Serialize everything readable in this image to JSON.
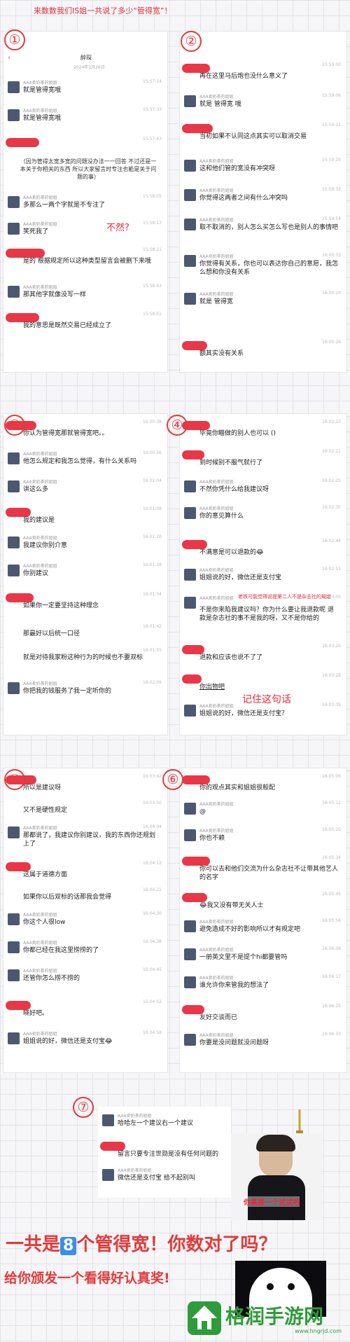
{
  "page": {
    "header_annotation": "来数数我们IS姐一共说了多少“管得宽”！",
    "sticker_text": "鬼鬼",
    "big_question": "一共是8个管得宽！你数对了吗？",
    "big_question_pre": "一共是",
    "big_question_num": "8",
    "big_question_post": "个管得宽！你数对了吗？",
    "award_text": "给你颁发一个看得好认真奖!",
    "watermark_site": "格润手游网",
    "watermark_url": "www.hngrjd.com"
  },
  "panels": [
    {
      "num": "①",
      "header_title": "醉琛",
      "header_date": "2024年3月26日",
      "annotations": [
        {
          "text": "不然?"
        }
      ],
      "messages": [
        {
          "kind": "named",
          "name": "AAA卖奶茶的姐姐",
          "text": "就是管得宽哦",
          "time": "15:57:14"
        },
        {
          "kind": "named",
          "name": "AAA卖奶茶的姐姐",
          "text": "就是管得宽哦",
          "time": "15:57:33"
        },
        {
          "kind": "smear",
          "text": "",
          "time": "15:57:43"
        },
        {
          "kind": "note",
          "text": "（因为管得太宽多宽的问题没办法一一回答 不过还是一本关于你相关的东西 所以大家留言时专注也能是关于问题的事）"
        },
        {
          "kind": "named",
          "name": "AAA卖奶茶的姐姐",
          "text": "多那么一两个字就是不专注了",
          "time": "15:58:05"
        },
        {
          "kind": "named",
          "name": "AAA卖奶茶的姐姐",
          "text": "笑死我了",
          "time": "15:58:13"
        },
        {
          "kind": "smear",
          "text": "是的 根据规定所以这种类型留言会被删下来哦",
          "time": "15:58:21"
        },
        {
          "kind": "named",
          "name": "AAA卖奶茶的姐姐",
          "text": "那其他字就像没写一样",
          "time": "15:58:43"
        },
        {
          "kind": "smear",
          "text": "我的意思是既然交易已经成立了",
          "time": "15:58:51"
        }
      ]
    },
    {
      "num": "②",
      "messages": [
        {
          "kind": "smear",
          "text": "再在这里马后炮也没什么意义了",
          "time": "15:59:00"
        },
        {
          "kind": "named",
          "name": "AAA卖奶茶的姐姐",
          "text": "就是 管得宽 哦",
          "time": "15:59:06"
        },
        {
          "kind": "smear",
          "text": "当初如果不认同这点其实可以取消交易",
          "time": "15:59:11"
        },
        {
          "kind": "named",
          "name": "AAA卖奶茶的姐姐",
          "text": "这和他们管的宽没有冲突呀",
          "time": "15:59:20"
        },
        {
          "kind": "named",
          "name": "AAA卖奶茶的姐姐",
          "text": "你觉得这两者之间有什么冲突吗",
          "time": "15:59:32"
        },
        {
          "kind": "named",
          "name": "AAA卖奶茶的姐姐",
          "text": "取不取消的，别人怎么买怎么写也是别人的事情吧",
          "time": "15:59:54"
        },
        {
          "kind": "named",
          "name": "AAA卖奶茶的姐姐",
          "text": "你觉得有关系，你也可以表达你自己的意愿，我怎么想和你没有关系",
          "time": "16:00:15"
        },
        {
          "kind": "named",
          "name": "AAA卖奶茶的姐姐",
          "text": "就是 管得宽",
          "time": "16:00:20"
        },
        {
          "kind": "smear",
          "text": "额其实没有关系",
          "time": "16:00:29"
        }
      ]
    },
    {
      "num": "③",
      "messages": [
        {
          "kind": "smear",
          "text": "你认为管得宽那就管得宽吧。。",
          "time": "16:00:38"
        },
        {
          "kind": "named",
          "name": "AAA卖奶茶的姐姐",
          "text": "他怎么规定和我怎么觉得，有什么关系吗",
          "time": "16:00:56"
        },
        {
          "kind": "named",
          "name": "AAA卖奶茶的姐姐",
          "text": "讲这么多",
          "time": "16:01:04"
        },
        {
          "kind": "smear",
          "text": "我的建议是",
          "time": "16:01:08"
        },
        {
          "kind": "named",
          "name": "AAA卖奶茶的姐姐",
          "text": "我建议你别介意",
          "time": "16:01:20"
        },
        {
          "kind": "named",
          "name": "AAA卖奶茶的姐姐",
          "text": "你别建议",
          "time": "16:01:28"
        },
        {
          "kind": "smear",
          "text": "如果你一定要坚持这种理念",
          "time": "16:01:34"
        },
        {
          "kind": "plain",
          "text": "那最好以后统一口径",
          "time": "16:01:42"
        },
        {
          "kind": "plain",
          "text": "就是对待我家粉这种行为的时候也不要双标",
          "time": "16:01:55"
        },
        {
          "kind": "named",
          "name": "AAA卖奶茶的姐姐",
          "text": "你把我的钱服务了我一定听你的",
          "time": "16:02:09"
        }
      ]
    },
    {
      "num": "④",
      "annotations": [
        {
          "text": "老铁可能觉得说提第二人不是杂志社的规定"
        },
        {
          "text": "记住这句话"
        }
      ],
      "messages": [
        {
          "kind": "smear",
          "text": "毕竟你瞄做的别人也可以 ()",
          "time": "16:02:15"
        },
        {
          "kind": "smear",
          "text": "到时候别不服气就行了",
          "time": "16:02:21"
        },
        {
          "kind": "named",
          "name": "AAA卖奶茶的姐姐",
          "text": "不然你凭什么给我建议呀",
          "time": "16:02:25"
        },
        {
          "kind": "named",
          "name": "AAA卖奶茶的姐姐",
          "text": "你的意见算什么",
          "time": "16:02:30"
        },
        {
          "kind": "smear",
          "text": "不满意是可以退款的😂",
          "time": "16:02:44"
        },
        {
          "kind": "named",
          "name": "AAA卖奶茶的姐姐",
          "text": "姐姐说的好，微信还是支付宝",
          "time": "16:02:51"
        },
        {
          "kind": "named",
          "name": "AAA卖奶茶的姐姐",
          "text": "不是你来陷我建议吗？你为什么要让我退款呢 退款是杂志社的事不是我的呀，又不是你给的",
          "time": "16:03:05"
        },
        {
          "kind": "smear",
          "text": "退款和应该也说不了了",
          "time": "16:03:20"
        },
        {
          "kind": "smear",
          "text": "你出物吧",
          "time": "16:03:28"
        },
        {
          "kind": "named",
          "name": "AAA卖奶茶的姐姐",
          "text": "姐姐说的好，微信还是支付宝？",
          "time": "16:03:35"
        }
      ]
    },
    {
      "num": "⑤",
      "messages": [
        {
          "kind": "smear",
          "text": "所以是建议呀",
          "time": "16:03:42"
        },
        {
          "kind": "plain",
          "text": "又不是硬性规定",
          "time": "16:03:50"
        },
        {
          "kind": "named",
          "name": "AAA卖奶茶的姐姐",
          "text": "那都说了，我建议你别建议，我的东西你还规划上了",
          "time": "16:04:04"
        },
        {
          "kind": "smear",
          "text": "这属于道德方面",
          "time": "16:04:12"
        },
        {
          "kind": "plain",
          "text": "如果你以后双标的话那我会觉得",
          "time": "16:04:21"
        },
        {
          "kind": "named",
          "name": "AAA卖奶茶的姐姐",
          "text": "你这个人很low",
          "time": "16:04:30"
        },
        {
          "kind": "named",
          "name": "AAA卖奶茶的姐姐",
          "text": "你都已经在我这里捞捞的了",
          "time": "16:04:38"
        },
        {
          "kind": "named",
          "name": "AAA卖奶茶的姐姐",
          "text": "还管你怎么捞不捞的",
          "time": "16:04:45"
        },
        {
          "kind": "smear",
          "text": "晓好吧。",
          "time": "16:04:52"
        },
        {
          "kind": "named",
          "name": "AAA卖奶茶的姐姐",
          "text": "姐姐说的好，微信还是支付宝😂",
          "time": "16:04:58"
        }
      ]
    },
    {
      "num": "⑥",
      "messages": [
        {
          "kind": "smear",
          "text": "你的观点其实和姐姐很般配",
          "time": "16:05:06"
        },
        {
          "kind": "named",
          "name": "AAA卖奶茶的姐姐",
          "text": "@",
          "time": "16:05:12"
        },
        {
          "kind": "named",
          "name": "AAA卖奶茶的姐姐",
          "text": "你也不赖",
          "time": "16:05:20"
        },
        {
          "kind": "smear",
          "text": "你可以去和他们交流为什么杂志社不让带其他艺人的名字",
          "time": "16:05:34"
        },
        {
          "kind": "smear",
          "text": "😂我又没有带无关人士",
          "time": "16:05:45"
        },
        {
          "kind": "named",
          "name": "AAA卖奶茶的姐姐",
          "text": "避免造成不好的影响所以才有规定吧",
          "time": "16:05:56"
        },
        {
          "kind": "named",
          "name": "AAA卖奶茶的姐姐",
          "text": "一册英文里不是提个hi都要管吗",
          "time": "16:06:08"
        },
        {
          "kind": "named",
          "name": "AAA卖奶茶的姐姐",
          "text": "谁允许你来管我的想法了",
          "time": "16:06:17"
        },
        {
          "kind": "smear",
          "text": "友好交谈而已",
          "time": "16:06:25"
        },
        {
          "kind": "named",
          "name": "AAA卖奶茶的姐姐",
          "text": "你要是没问题就没问题呀",
          "time": "16:06:33"
        }
      ]
    },
    {
      "num": "⑦",
      "poster_text": "你真是一个试试吧",
      "messages": [
        {
          "kind": "named",
          "name": "AAA卖奶茶的姐姐",
          "text": "哈哈左一个建议右一个建议",
          "time": ""
        },
        {
          "kind": "smear",
          "text": "留言只要专注世勋是没有任何问题的",
          "time": ""
        },
        {
          "kind": "named",
          "name": "AAA卖奶茶的姐姐",
          "text": "微信还是支付宝 给不起别叫",
          "time": ""
        }
      ]
    }
  ],
  "colors": {
    "accent_red": "#e8283a",
    "big_text_red": "#e23a3a",
    "num_badge_blue": "#3a8ee6",
    "watermark_green": "#2e9c3a"
  }
}
